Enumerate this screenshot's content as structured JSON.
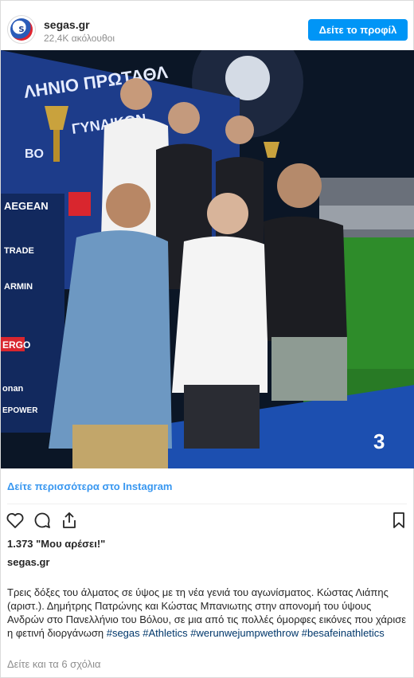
{
  "header": {
    "username": "segas.gr",
    "followers": "22,4K ακόλουθοι",
    "profile_button": "Δείτε το προφίλ"
  },
  "photo": {
    "description_icon": "photo-image",
    "banner_text_top": "ΛΗΝΙΟ ΠΡΩΤΑΘΛ",
    "banner_text_mid": "ΓΥΝΑΙΚΩΝ",
    "banner_text_vol": "ΒΟ",
    "sponsors": [
      "AEGEAN",
      "TRADE",
      "ARMIN",
      "ERGO",
      "onan",
      "EPOWER",
      "EGEAN"
    ],
    "podium_number": "3",
    "colors": {
      "sky": "#0b1626",
      "field": "#2e8c2a",
      "banner": "#1d3c8a",
      "podium": "#1c4fb0"
    }
  },
  "more_link": "Δείτε περισσότερα στο Instagram",
  "actions": {
    "like_icon": "heart-icon",
    "comment_icon": "comment-icon",
    "share_icon": "share-icon",
    "save_icon": "bookmark-icon"
  },
  "likes": "1.373 \"Μου αρέσει!\"",
  "owner": "segas.gr",
  "caption": {
    "text": "Τρεις δόξες του άλματος σε ύψος με τη νέα γενιά του αγωνίσματος. Κώστας Λιάπης (αριστ.). Δημήτρης Πατρώνης και Κώστας Μπανιωτης στην απονομή του ύψους Ανδρών στο Πανελλήνιο του Βόλου, σε μια από τις πολλές όμορφες εικόνες που χάρισε η φετινή διοργάνωση ",
    "hashtags": [
      "#segas",
      "#Athletics",
      "#werunwejumpwethrow",
      "#besafeinathletics"
    ]
  },
  "comments": "Δείτε και τα 6 σχόλια"
}
